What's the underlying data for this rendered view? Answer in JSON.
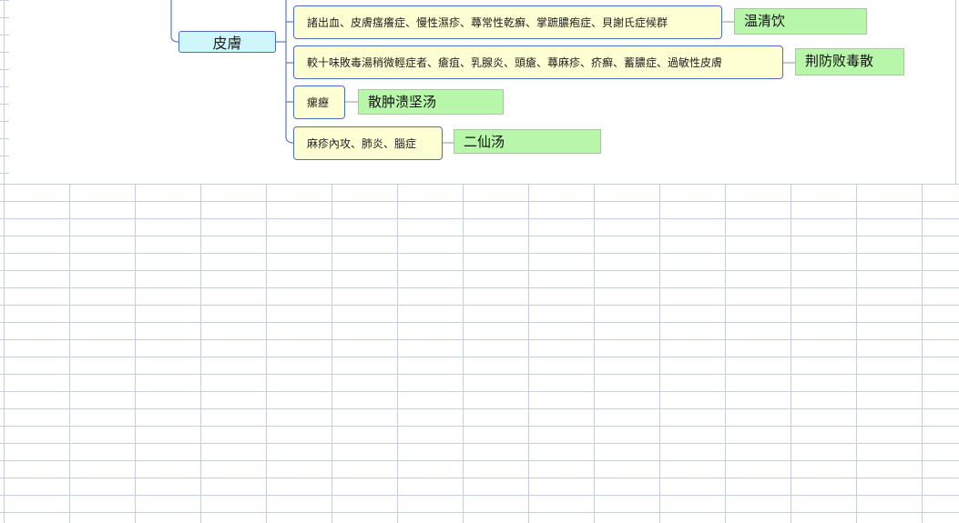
{
  "mindmap": {
    "root": {
      "label": "皮膚"
    },
    "branches": [
      {
        "label": "諸出血、皮膚瘙癢症、慢性濕疹、蕁常性乾癬、掌蹠膿疱症、貝謝氏症候群",
        "tag": "温清饮"
      },
      {
        "label": "較十味敗毒湯稍微輕症者、瘡疽、乳腺炎、頭瘡、蕁麻疹、疥癬、蓄膿症、過敏性皮膚",
        "tag": "荆防败毒散"
      },
      {
        "label": "瘰癧",
        "tag": "散肿溃坚汤"
      },
      {
        "label": "麻疹內攻、肺炎、腦症",
        "tag": "二仙汤"
      }
    ]
  },
  "colors": {
    "node_fill": "#ffffd4",
    "node_border": "#4c6fb8",
    "root_fill": "#cff6fb",
    "tag_fill": "#b8f7a9",
    "grid_line": "#c7cfdf"
  }
}
